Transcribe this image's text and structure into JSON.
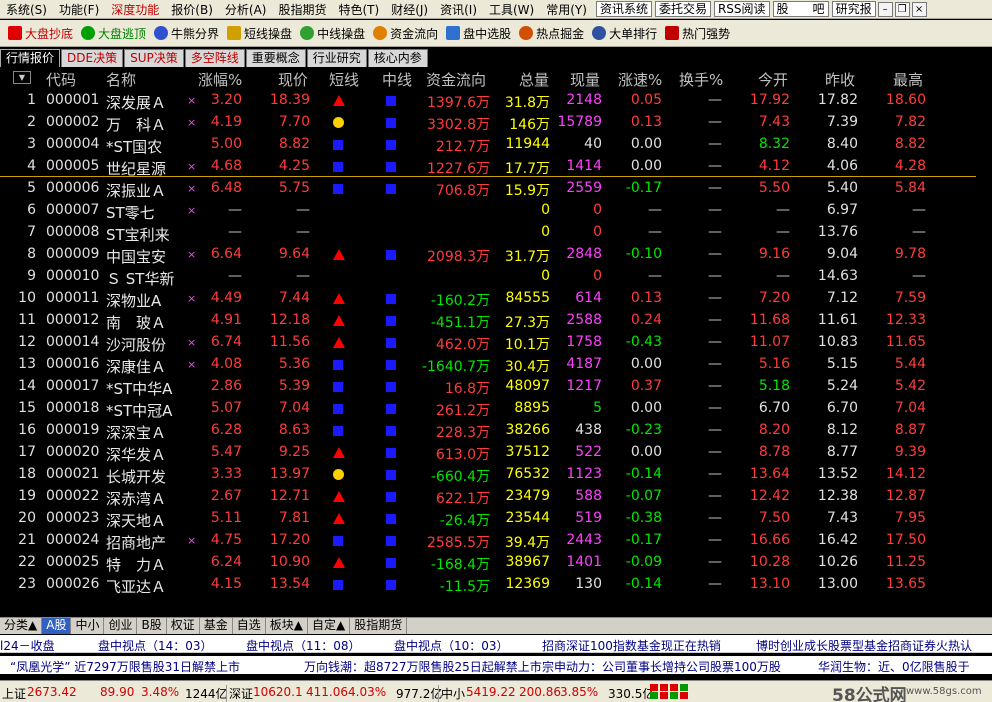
{
  "menubar": {
    "items": [
      "系统(S)",
      "功能(F)",
      "深度功能",
      "报价(B)",
      "分析(A)",
      "股指期货",
      "特色(T)",
      "财经(J)",
      "资讯(I)",
      "工具(W)",
      "常用(Y)"
    ],
    "buttons": [
      "资讯系统",
      "委托交易",
      "RSS阅读",
      "股　　吧",
      "研究报"
    ]
  },
  "toolbar": {
    "items": [
      {
        "label": "大盘抄底",
        "icon": "trend-up-icon",
        "color": "#c00000"
      },
      {
        "label": "大盘逃顶",
        "icon": "trend-down-icon",
        "color": "#008000"
      },
      {
        "label": "牛熊分界",
        "icon": "bull-bear-icon",
        "color": "#000000"
      },
      {
        "label": "短线操盘",
        "icon": "short-term-icon",
        "color": "#000000"
      },
      {
        "label": "中线操盘",
        "icon": "mid-term-icon",
        "color": "#000000"
      },
      {
        "label": "资金流向",
        "icon": "money-flow-icon",
        "color": "#000000"
      },
      {
        "label": "盘中选股",
        "icon": "stock-pick-icon",
        "color": "#000000"
      },
      {
        "label": "热点掘金",
        "icon": "hotspot-icon",
        "color": "#000000"
      },
      {
        "label": "大单排行",
        "icon": "big-order-icon",
        "color": "#000000"
      },
      {
        "label": "热门强势",
        "icon": "hot-strong-icon",
        "color": "#000000"
      }
    ]
  },
  "tabs": [
    "行情报价",
    "DDE决策",
    "SUP决策",
    "多空阵线",
    "重要概念",
    "行业研究",
    "核心内参"
  ],
  "table": {
    "headers": {
      "code": "代码",
      "name": "名称",
      "chg": "涨幅%",
      "price": "现价",
      "short": "短线",
      "mid": "中线",
      "flow": "资金流向",
      "vol": "总量",
      "cur": "现量",
      "speed": "涨速%",
      "turn": "换手%",
      "open": "今开",
      "prev": "昨收",
      "high": "最高"
    },
    "rows": [
      {
        "num": "1",
        "code": "000001",
        "name": "深发展Ａ",
        "mark": "×",
        "chg": "3.20",
        "price": "18.39",
        "short": "tri",
        "mid": "sq",
        "flow": "1397.6万",
        "vol": "31.8万",
        "cur": "2148",
        "curc": "mag",
        "speed": "0.05",
        "turn": "—",
        "open": "17.92",
        "prev": "17.82",
        "high": "18.60",
        "dir": "up",
        "speedDir": "up",
        "openDir": "up",
        "highDir": "up"
      },
      {
        "num": "2",
        "code": "000002",
        "name": "万　科Ａ",
        "mark": "×",
        "chg": "4.19",
        "price": "7.70",
        "short": "dot",
        "mid": "sq",
        "flow": "3302.8万",
        "vol": "146万",
        "cur": "15789",
        "curc": "mag",
        "speed": "0.13",
        "turn": "—",
        "open": "7.43",
        "prev": "7.39",
        "high": "7.82",
        "dir": "up",
        "speedDir": "up",
        "openDir": "up",
        "highDir": "up"
      },
      {
        "num": "3",
        "code": "000004",
        "name": "*ST国农",
        "mark": "",
        "chg": "5.00",
        "price": "8.82",
        "short": "sq",
        "mid": "sq",
        "flow": "212.7万",
        "vol": "11944",
        "cur": "40",
        "curc": "flat",
        "speed": "0.00",
        "turn": "—",
        "open": "8.32",
        "prev": "8.40",
        "high": "8.82",
        "dir": "up",
        "speedDir": "flat",
        "openDir": "down",
        "highDir": "up"
      },
      {
        "num": "4",
        "code": "000005",
        "name": "世纪星源",
        "mark": "×",
        "chg": "4.68",
        "price": "4.25",
        "short": "sq",
        "mid": "sq",
        "flow": "1227.6万",
        "vol": "17.7万",
        "cur": "1414",
        "curc": "mag",
        "speed": "0.00",
        "turn": "—",
        "open": "4.12",
        "prev": "4.06",
        "high": "4.28",
        "dir": "up",
        "speedDir": "flat",
        "openDir": "up",
        "highDir": "up"
      },
      {
        "num": "5",
        "code": "000006",
        "name": "深振业Ａ",
        "mark": "×",
        "chg": "6.48",
        "price": "5.75",
        "short": "sq",
        "mid": "sq",
        "flow": "706.8万",
        "vol": "15.9万",
        "cur": "2559",
        "curc": "mag",
        "speed": "-0.17",
        "turn": "—",
        "open": "5.50",
        "prev": "5.40",
        "high": "5.84",
        "dir": "up",
        "speedDir": "down",
        "openDir": "up",
        "highDir": "up"
      },
      {
        "num": "6",
        "code": "000007",
        "name": "ST零七",
        "mark": "×",
        "chg": "—",
        "price": "—",
        "short": "",
        "mid": "",
        "flow": "",
        "vol": "0",
        "cur": "0",
        "curc": "up",
        "speed": "—",
        "turn": "—",
        "open": "—",
        "prev": "6.97",
        "high": "—",
        "dir": "dash",
        "speedDir": "dash",
        "openDir": "dash",
        "highDir": "dash"
      },
      {
        "num": "7",
        "code": "000008",
        "name": "ST宝利来",
        "mark": "",
        "chg": "—",
        "price": "—",
        "short": "",
        "mid": "",
        "flow": "",
        "vol": "0",
        "cur": "0",
        "curc": "up",
        "speed": "—",
        "turn": "—",
        "open": "—",
        "prev": "13.76",
        "high": "—",
        "dir": "dash",
        "speedDir": "dash",
        "openDir": "dash",
        "highDir": "dash"
      },
      {
        "num": "8",
        "code": "000009",
        "name": "中国宝安",
        "mark": "×",
        "chg": "6.64",
        "price": "9.64",
        "short": "tri",
        "mid": "sq",
        "flow": "2098.3万",
        "vol": "31.7万",
        "cur": "2848",
        "curc": "mag",
        "speed": "-0.10",
        "turn": "—",
        "open": "9.16",
        "prev": "9.04",
        "high": "9.78",
        "dir": "up",
        "speedDir": "down",
        "openDir": "up",
        "highDir": "up"
      },
      {
        "num": "9",
        "code": "000010",
        "name": "Ｓ ST华新",
        "mark": "",
        "chg": "—",
        "price": "—",
        "short": "",
        "mid": "",
        "flow": "",
        "vol": "0",
        "cur": "0",
        "curc": "up",
        "speed": "—",
        "turn": "—",
        "open": "—",
        "prev": "14.63",
        "high": "—",
        "dir": "dash",
        "speedDir": "dash",
        "openDir": "dash",
        "highDir": "dash"
      },
      {
        "num": "10",
        "code": "000011",
        "name": "深物业A",
        "mark": "×",
        "chg": "4.49",
        "price": "7.44",
        "short": "tri",
        "mid": "sq",
        "flow": "-160.2万",
        "vol": "84555",
        "cur": "614",
        "curc": "mag",
        "speed": "0.13",
        "turn": "—",
        "open": "7.20",
        "prev": "7.12",
        "high": "7.59",
        "dir": "up",
        "speedDir": "up",
        "openDir": "up",
        "highDir": "up"
      },
      {
        "num": "11",
        "code": "000012",
        "name": "南　玻Ａ",
        "mark": "",
        "chg": "4.91",
        "price": "12.18",
        "short": "tri",
        "mid": "sq",
        "flow": "-451.1万",
        "vol": "27.3万",
        "cur": "2588",
        "curc": "mag",
        "speed": "0.24",
        "turn": "—",
        "open": "11.68",
        "prev": "11.61",
        "high": "12.33",
        "dir": "up",
        "speedDir": "up",
        "openDir": "up",
        "highDir": "up"
      },
      {
        "num": "12",
        "code": "000014",
        "name": "沙河股份",
        "mark": "×",
        "chg": "6.74",
        "price": "11.56",
        "short": "tri",
        "mid": "sq",
        "flow": "462.0万",
        "vol": "10.1万",
        "cur": "1758",
        "curc": "mag",
        "speed": "-0.43",
        "turn": "—",
        "open": "11.07",
        "prev": "10.83",
        "high": "11.65",
        "dir": "up",
        "speedDir": "down",
        "openDir": "up",
        "highDir": "up"
      },
      {
        "num": "13",
        "code": "000016",
        "name": "深康佳Ａ",
        "mark": "×",
        "chg": "4.08",
        "price": "5.36",
        "short": "sq",
        "mid": "sq",
        "flow": "-1640.7万",
        "vol": "30.4万",
        "cur": "4187",
        "curc": "mag",
        "speed": "0.00",
        "turn": "—",
        "open": "5.16",
        "prev": "5.15",
        "high": "5.44",
        "dir": "up",
        "speedDir": "flat",
        "openDir": "up",
        "highDir": "up"
      },
      {
        "num": "14",
        "code": "000017",
        "name": "*ST中华A",
        "mark": "",
        "chg": "2.86",
        "price": "5.39",
        "short": "sq",
        "mid": "sq",
        "flow": "16.8万",
        "vol": "48097",
        "cur": "1217",
        "curc": "mag",
        "speed": "0.37",
        "turn": "—",
        "open": "5.18",
        "prev": "5.24",
        "high": "5.42",
        "dir": "up",
        "speedDir": "up",
        "openDir": "down",
        "highDir": "up"
      },
      {
        "num": "15",
        "code": "000018",
        "name": "*ST中冠A",
        "mark": "",
        "chg": "5.07",
        "price": "7.04",
        "short": "sq",
        "mid": "sq",
        "flow": "261.2万",
        "vol": "8895",
        "cur": "5",
        "curc": "down",
        "speed": "0.00",
        "turn": "—",
        "open": "6.70",
        "prev": "6.70",
        "high": "7.04",
        "dir": "up",
        "speedDir": "flat",
        "openDir": "flat",
        "highDir": "up"
      },
      {
        "num": "16",
        "code": "000019",
        "name": "深深宝Ａ",
        "mark": "",
        "chg": "6.28",
        "price": "8.63",
        "short": "sq",
        "mid": "sq",
        "flow": "228.3万",
        "vol": "38266",
        "cur": "438",
        "curc": "flat",
        "speed": "-0.23",
        "turn": "—",
        "open": "8.20",
        "prev": "8.12",
        "high": "8.87",
        "dir": "up",
        "speedDir": "down",
        "openDir": "up",
        "highDir": "up"
      },
      {
        "num": "17",
        "code": "000020",
        "name": "深华发Ａ",
        "mark": "",
        "chg": "5.47",
        "price": "9.25",
        "short": "tri",
        "mid": "sq",
        "flow": "613.0万",
        "vol": "37512",
        "cur": "522",
        "curc": "mag",
        "speed": "0.00",
        "turn": "—",
        "open": "8.78",
        "prev": "8.77",
        "high": "9.39",
        "dir": "up",
        "speedDir": "flat",
        "openDir": "up",
        "highDir": "up"
      },
      {
        "num": "18",
        "code": "000021",
        "name": "长城开发",
        "mark": "",
        "chg": "3.33",
        "price": "13.97",
        "short": "dot",
        "mid": "sq",
        "flow": "-660.4万",
        "vol": "76532",
        "cur": "1123",
        "curc": "mag",
        "speed": "-0.14",
        "turn": "—",
        "open": "13.64",
        "prev": "13.52",
        "high": "14.12",
        "dir": "up",
        "speedDir": "down",
        "openDir": "up",
        "highDir": "up"
      },
      {
        "num": "19",
        "code": "000022",
        "name": "深赤湾Ａ",
        "mark": "",
        "chg": "2.67",
        "price": "12.71",
        "short": "tri",
        "mid": "sq",
        "flow": "622.1万",
        "vol": "23479",
        "cur": "588",
        "curc": "mag",
        "speed": "-0.07",
        "turn": "—",
        "open": "12.42",
        "prev": "12.38",
        "high": "12.87",
        "dir": "up",
        "speedDir": "down",
        "openDir": "up",
        "highDir": "up"
      },
      {
        "num": "20",
        "code": "000023",
        "name": "深天地Ａ",
        "mark": "",
        "chg": "5.11",
        "price": "7.81",
        "short": "tri",
        "mid": "sq",
        "flow": "-26.4万",
        "vol": "23544",
        "cur": "519",
        "curc": "mag",
        "speed": "-0.38",
        "turn": "—",
        "open": "7.50",
        "prev": "7.43",
        "high": "7.95",
        "dir": "up",
        "speedDir": "down",
        "openDir": "up",
        "highDir": "up"
      },
      {
        "num": "21",
        "code": "000024",
        "name": "招商地产",
        "mark": "×",
        "chg": "4.75",
        "price": "17.20",
        "short": "sq",
        "mid": "sq",
        "flow": "2585.5万",
        "vol": "39.4万",
        "cur": "2443",
        "curc": "mag",
        "speed": "-0.17",
        "turn": "—",
        "open": "16.66",
        "prev": "16.42",
        "high": "17.50",
        "dir": "up",
        "speedDir": "down",
        "openDir": "up",
        "highDir": "up"
      },
      {
        "num": "22",
        "code": "000025",
        "name": "特　力Ａ",
        "mark": "",
        "chg": "6.24",
        "price": "10.90",
        "short": "tri",
        "mid": "sq",
        "flow": "-168.4万",
        "vol": "38967",
        "cur": "1401",
        "curc": "mag",
        "speed": "-0.09",
        "turn": "—",
        "open": "10.28",
        "prev": "10.26",
        "high": "11.25",
        "dir": "up",
        "speedDir": "down",
        "openDir": "up",
        "highDir": "up"
      },
      {
        "num": "23",
        "code": "000026",
        "name": "飞亚达Ａ",
        "mark": "",
        "chg": "4.15",
        "price": "13.54",
        "short": "sq",
        "mid": "sq",
        "flow": "-11.5万",
        "vol": "12369",
        "cur": "130",
        "curc": "flat",
        "speed": "-0.14",
        "turn": "—",
        "open": "13.10",
        "prev": "13.00",
        "high": "13.65",
        "dir": "up",
        "speedDir": "down",
        "openDir": "up",
        "highDir": "up"
      }
    ]
  },
  "bottom_tabs": [
    "分类▲",
    "A股",
    "中小",
    "创业",
    "B股",
    "权证",
    "基金",
    "自选",
    "板块▲",
    "自定▲",
    "股指期货"
  ],
  "news": {
    "line1": [
      "l24－收盘",
      "盘中视点（14：03）",
      "盘中视点（11：08）",
      "盘中视点（10：03）",
      "招商深证100指数基金现正在热销",
      "博时创业成长股票型基金招商证券火热认"
    ],
    "line2": [
      "“凤凰光学” 近7297万限售股31日解禁上市",
      "万向钱潮：超8727万限售股25日起解禁上市",
      "宗申动力：公司董事长增持公司股票100万股",
      "华润生物：近、0亿限售股于"
    ]
  },
  "status": {
    "sh_label": "上证",
    "sh_index": "2673.42",
    "sh_chg": "89.90",
    "sh_pct": "3.48%",
    "sh_amt": "1244亿",
    "sz_label": "深证",
    "sz_index": "10620.1",
    "sz_chg": "411.06",
    "sz_pct": "4.03%",
    "sz_amt": "977.2亿",
    "zx_label": "中小",
    "zx_index": "5419.22",
    "zx_chg": "200.86",
    "zx_pct": "3.85%",
    "zx_amt": "330.5亿",
    "watermark": "58公式网",
    "watermark_url": "www.58gs.com"
  }
}
